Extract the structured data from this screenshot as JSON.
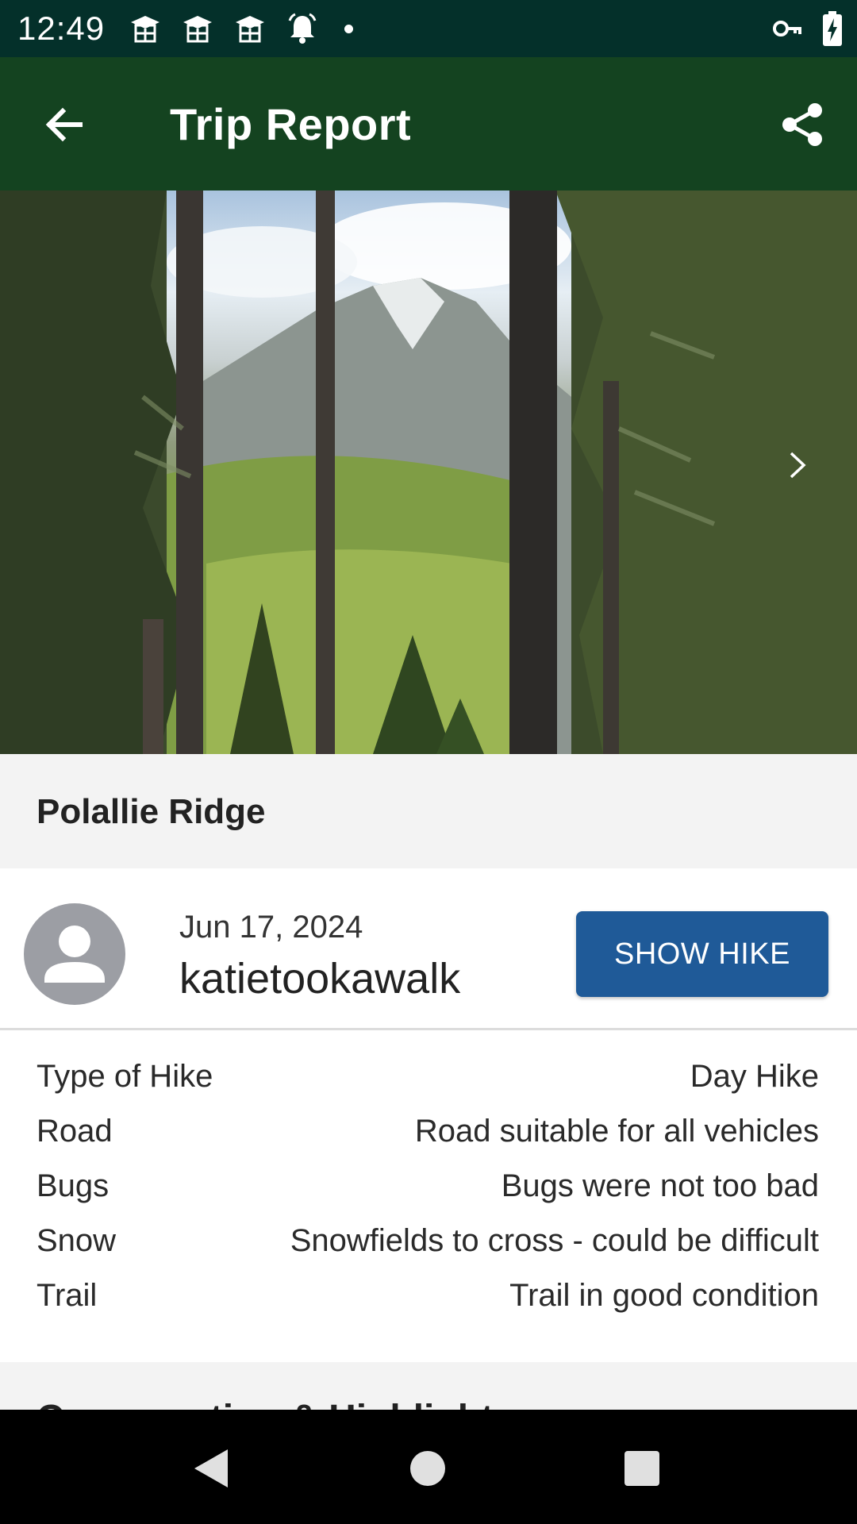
{
  "status_bar": {
    "time": "12:49",
    "notification_icons": [
      "graduation-cap-icon",
      "graduation-cap-icon",
      "graduation-cap-icon",
      "alarm-bell-icon"
    ],
    "right_icons": [
      "vpn-key-icon",
      "battery-charging-icon"
    ]
  },
  "app_bar": {
    "title": "Trip Report",
    "back_icon": "arrow-back-icon",
    "share_icon": "share-icon"
  },
  "photo": {
    "next_icon": "chevron-right-icon"
  },
  "trail": {
    "name": "Polallie Ridge"
  },
  "report": {
    "date": "Jun 17, 2024",
    "author": "katietookawalk",
    "show_hike_label": "SHOW HIKE"
  },
  "conditions": [
    {
      "label": "Type of Hike",
      "value": "Day Hike"
    },
    {
      "label": "Road",
      "value": "Road suitable for all vehicles"
    },
    {
      "label": "Bugs",
      "value": "Bugs were not too bad"
    },
    {
      "label": "Snow",
      "value": "Snowfields to cross - could be difficult"
    },
    {
      "label": "Trail",
      "value": "Trail in good condition"
    }
  ],
  "next_section": {
    "heading": "Conservation & Highlights"
  },
  "colors": {
    "status_bar": "#04302a",
    "app_bar": "#144320",
    "button": "#1f5a98"
  }
}
